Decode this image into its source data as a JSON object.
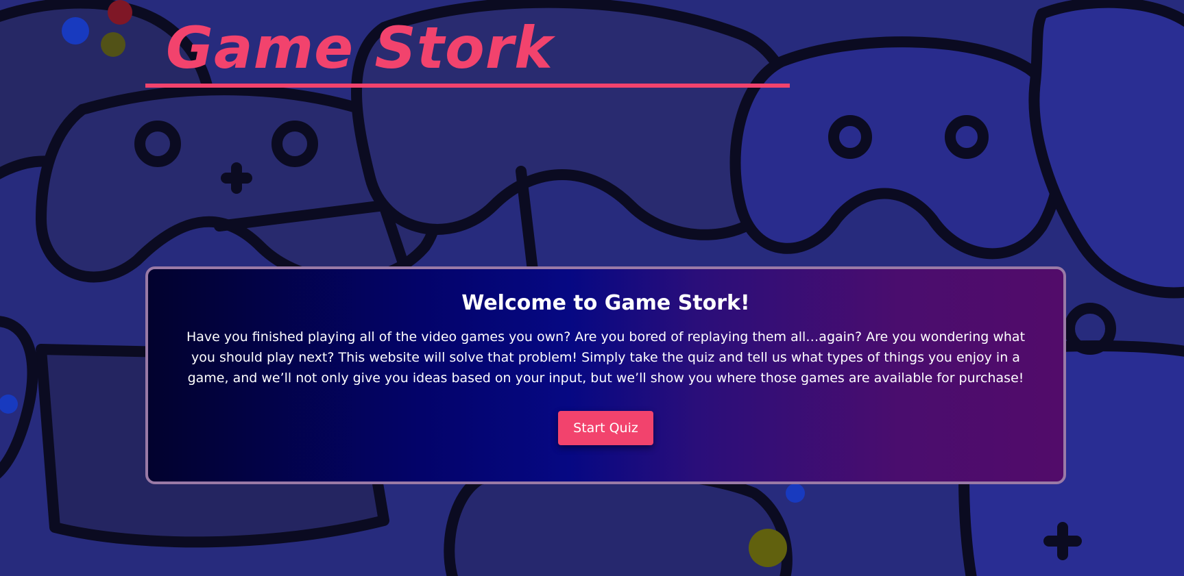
{
  "header": {
    "logo": "Game Stork"
  },
  "welcome": {
    "title": "Welcome to Game Stork!",
    "description": "Have you finished playing all of the video games you own? Are you bored of replaying them all…again? Are you wondering what you should play next? This website will solve that problem! Simply take the quiz and tell us what types of things you enjoy in a game, and we’ll not only give you ideas based on your input, but we’ll show you where those games are available for purchase!",
    "button_label": "Start Quiz"
  },
  "colors": {
    "accent": "#f2436d",
    "background": "#2a2f86",
    "card_border": "#9a7aa6"
  },
  "icons": {
    "background": "game-controllers-pattern"
  }
}
